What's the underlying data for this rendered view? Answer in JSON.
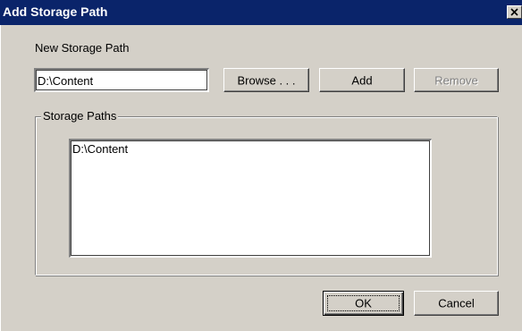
{
  "window": {
    "title": "Add Storage Path"
  },
  "form": {
    "new_path_label": "New Storage Path",
    "new_path_value": "D:\\Content",
    "browse_label": "Browse . . .",
    "add_label": "Add",
    "remove_label": "Remove",
    "remove_enabled": false
  },
  "storage_paths": {
    "group_label": "Storage Paths",
    "items": [
      {
        "label": "D:\\Content"
      }
    ]
  },
  "footer": {
    "ok_label": "OK",
    "cancel_label": "Cancel"
  },
  "icons": {
    "close": "close-icon"
  },
  "colors": {
    "titlebar": "#0a246a",
    "face": "#d4d0c8"
  }
}
